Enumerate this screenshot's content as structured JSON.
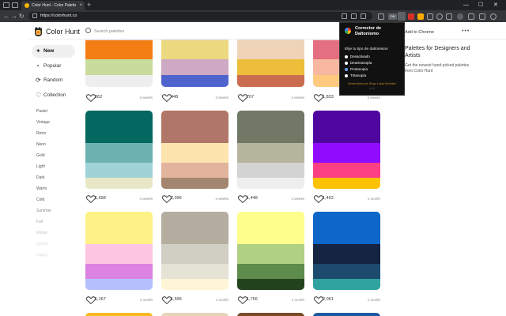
{
  "browser": {
    "tab_title": "Color Hunt - Color Palettes for De...",
    "tab_close": "×",
    "new_tab": "+",
    "url": "https://colorhunt.co",
    "win_min": "—",
    "win_max": "☐",
    "win_close": "✕",
    "nav_back": "←",
    "nav_forward": "→",
    "nav_reload": "↻",
    "ext_badge": "ON"
  },
  "header": {
    "logo_text": "Color Hunt",
    "search_placeholder": "Search palettes"
  },
  "sidebar": {
    "items": [
      {
        "icon": "✦",
        "label": "New"
      },
      {
        "icon": "◔",
        "label": "Popular"
      },
      {
        "icon": "⟳",
        "label": "Random"
      },
      {
        "icon": "♡",
        "label": "Collection"
      }
    ],
    "tags": [
      "Pastel",
      "Vintage",
      "Retro",
      "Neon",
      "Gold",
      "Light",
      "Dark",
      "Warm",
      "Cold",
      "Summer",
      "Fall",
      "Winter",
      "Spring",
      "Happy"
    ]
  },
  "palettes": [
    {
      "colors": [
        "#f57e14",
        "#c8dc9c",
        "#eeeeee"
      ],
      "likes": "862",
      "age": "3 weeks"
    },
    {
      "colors": [
        "#ecd87f",
        "#cea9c4",
        "#4f64cc"
      ],
      "likes": "448",
      "age": "3 weeks"
    },
    {
      "colors": [
        "#efd4b8",
        "#ecbe3a",
        "#c96c4f"
      ],
      "likes": "707",
      "age": "3 weeks"
    },
    {
      "colors": [
        "#e46f80",
        "#f7b7a0",
        "#ffca80"
      ],
      "likes": "1,833",
      "age": "3 weeks"
    },
    {
      "colors": [
        "#03685f",
        "#6db2b0",
        "#9fd3d8",
        "#e8e8c8"
      ],
      "likes": "1,698",
      "age": "4 weeks"
    },
    {
      "colors": [
        "#b07667",
        "#fde3ad",
        "#e2b49d",
        "#a48670"
      ],
      "likes": "2,096",
      "age": "4 weeks"
    },
    {
      "colors": [
        "#717966",
        "#b5b59e",
        "#d3d3d3",
        "#eeeeee"
      ],
      "likes": "1,448",
      "age": "4 weeks"
    },
    {
      "colors": [
        "#4f069e",
        "#8f0cff",
        "#fd3f83",
        "#fdc204"
      ],
      "likes": "1,452",
      "age": "1 month"
    },
    {
      "colors": [
        "#fef286",
        "#fec6e2",
        "#dc82e3",
        "#b5c0fe"
      ],
      "likes": "1,167",
      "age": "1 month"
    },
    {
      "colors": [
        "#b5ad9f",
        "#d1cec3",
        "#e5e2d6",
        "#fdf5d6"
      ],
      "likes": "1,595",
      "age": "1 month"
    },
    {
      "colors": [
        "#fefe8c",
        "#b0d084",
        "#5d8c4c",
        "#23421e"
      ],
      "likes": "1,756",
      "age": "1 month"
    },
    {
      "colors": [
        "#0d66c8",
        "#142442",
        "#1c4b6e",
        "#30a2a0"
      ],
      "likes": "2,061",
      "age": "1 month"
    }
  ],
  "next_row_colors": [
    "#f7b91f",
    "#e8d5b9",
    "#7a4b26",
    "#1c59a4"
  ],
  "promo": {
    "add_text": "Add to Chrome",
    "dots": "•••",
    "title": "Palettes for Designers and Artists",
    "subtitle": "Get the newest hand-picked palettes from Color Hunt"
  },
  "popup": {
    "title": "Corrector de Daltonismo",
    "prompt": "Elije tu tipo de daltonismo",
    "options": [
      "Desactivado",
      "Deuteranopía",
      "Protanopía",
      "Tritanopía"
    ],
    "selected_index": 2,
    "credit": "Desarrollado por Diego López Beneitez",
    "version": "v1.0"
  }
}
